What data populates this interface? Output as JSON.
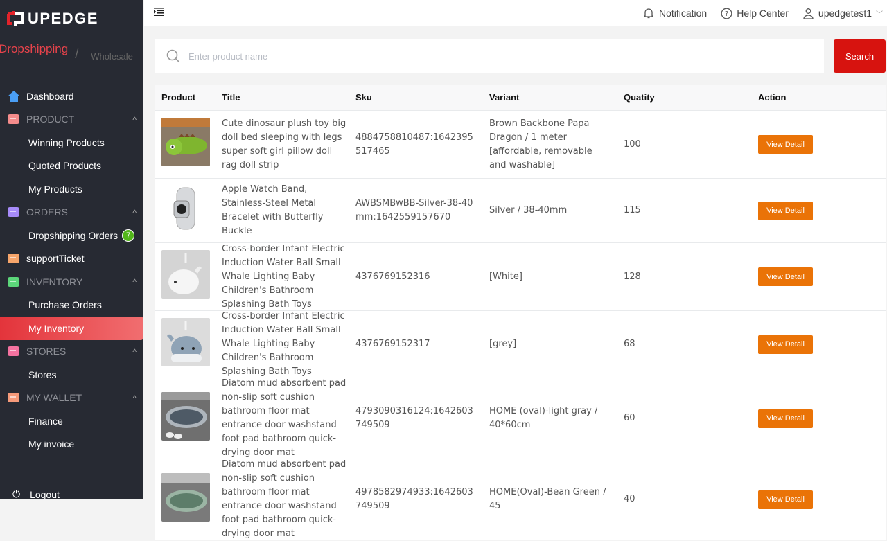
{
  "brand": {
    "name": "UPEDGE",
    "accent": "#e3343b"
  },
  "mode": {
    "active": "Dropshipping",
    "separator": "/",
    "inactive": "Wholesale"
  },
  "sidebar": {
    "items": [
      {
        "type": "top",
        "label": "Dashboard",
        "icon": "home-icon",
        "color": "#4a9ef5"
      },
      {
        "type": "group",
        "label": "PRODUCT",
        "icon": "product-icon",
        "color": "#f58c8c"
      },
      {
        "type": "sub",
        "label": "Winning Products"
      },
      {
        "type": "sub",
        "label": "Quoted Products"
      },
      {
        "type": "sub",
        "label": "My Products"
      },
      {
        "type": "group",
        "label": "ORDERS",
        "icon": "orders-icon",
        "color": "#a78bfa"
      },
      {
        "type": "sub",
        "label": "Dropshipping Orders",
        "badge": "7"
      },
      {
        "type": "top",
        "label": "supportTicket",
        "icon": "ticket-icon",
        "color": "#f6a56b"
      },
      {
        "type": "group",
        "label": "INVENTORY",
        "icon": "inventory-icon",
        "color": "#5cd67a"
      },
      {
        "type": "sub",
        "label": "Purchase Orders"
      },
      {
        "type": "sub",
        "label": "My Inventory",
        "active": true
      },
      {
        "type": "group",
        "label": "STORES",
        "icon": "stores-icon",
        "color": "#f472a0"
      },
      {
        "type": "sub",
        "label": "Stores"
      },
      {
        "type": "group",
        "label": "MY WALLET",
        "icon": "wallet-icon",
        "color": "#f59a7a"
      },
      {
        "type": "sub",
        "label": "Finance"
      },
      {
        "type": "sub",
        "label": "My invoice"
      }
    ],
    "logout": "Logout"
  },
  "topbar": {
    "notification": "Notification",
    "help": "Help Center",
    "user": "upedgetest1"
  },
  "search": {
    "placeholder": "Enter product name",
    "value": "",
    "button": "Search"
  },
  "table": {
    "headers": [
      "Product",
      "Title",
      "Sku",
      "Variant",
      "Quatity",
      "Action"
    ],
    "rows": [
      {
        "title": "Cute dinosaur plush toy big doll bed sleeping with legs super soft girl pillow doll rag doll strip",
        "sku": "4884758810487:1642395517465",
        "variant": "Brown Backbone Papa Dragon / 1 meter [affordable, removable and washable]",
        "qty": "100",
        "action": "View Detail",
        "thumb": "dinosaur-plush"
      },
      {
        "title": "Apple Watch Band, Stainless-Steel Metal Bracelet with Butterfly Buckle",
        "sku": "AWBSMBwBB-Silver-38-40mm:1642559157670",
        "variant": "Silver / 38-40mm",
        "qty": "115",
        "action": "View Detail",
        "thumb": "watch-band"
      },
      {
        "title": "Cross-border Infant Electric Induction Water Ball Small Whale Lighting Baby Children's Bathroom Splashing Bath Toys",
        "sku": "4376769152316",
        "variant": "[White]",
        "qty": "128",
        "action": "View Detail",
        "thumb": "whale-white"
      },
      {
        "title": "Cross-border Infant Electric Induction Water Ball Small Whale Lighting Baby Children's Bathroom Splashing Bath Toys",
        "sku": "4376769152317",
        "variant": "[grey]",
        "qty": "68",
        "action": "View Detail",
        "thumb": "whale-grey"
      },
      {
        "title": "Diatom mud absorbent pad non-slip soft cushion bathroom floor mat entrance door washstand foot pad bathroom quick-drying door mat",
        "sku": "4793090316124:1642603749509",
        "variant": "HOME (oval)-light gray / 40*60cm",
        "qty": "60",
        "action": "View Detail",
        "thumb": "mat-gray"
      },
      {
        "title": "Diatom mud absorbent pad non-slip soft cushion bathroom floor mat entrance door washstand foot pad bathroom quick-drying door mat",
        "sku": "4978582974933:1642603749509",
        "variant": "HOME(Oval)-Bean Green / 45",
        "qty": "40",
        "action": "View Detail",
        "thumb": "mat-green"
      }
    ]
  }
}
